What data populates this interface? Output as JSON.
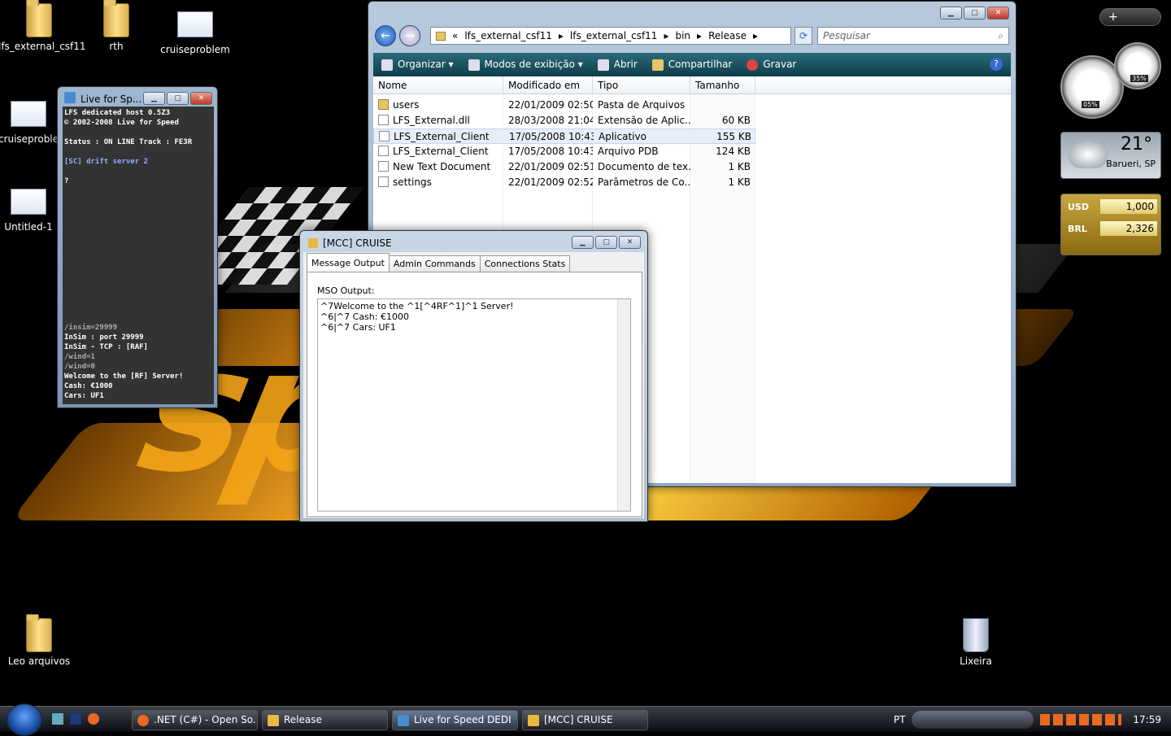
{
  "desktop": {
    "icons": [
      {
        "label": "lfs_external_csf11",
        "type": "folder"
      },
      {
        "label": "rth",
        "type": "folder"
      },
      {
        "label": "cruiseproblem",
        "type": "image"
      },
      {
        "label": "cruiseproble",
        "type": "image"
      },
      {
        "label": "Untitled-1",
        "type": "image"
      },
      {
        "label": "Leo arquivos",
        "type": "folder"
      },
      {
        "label": "Lixeira",
        "type": "recycle-bin"
      }
    ]
  },
  "explorer": {
    "breadcrumb": [
      "«",
      "lfs_external_csf11",
      "lfs_external_csf11",
      "bin",
      "Release"
    ],
    "search_placeholder": "Pesquisar",
    "toolbar": {
      "organize": "Organizar",
      "views": "Modos de exibição",
      "open": "Abrir",
      "share": "Compartilhar",
      "burn": "Gravar"
    },
    "columns": [
      "Nome",
      "Modificado em",
      "Tipo",
      "Tamanho"
    ],
    "files": [
      {
        "name": "users",
        "modified": "22/01/2009 02:50",
        "type": "Pasta de Arquivos",
        "size": ""
      },
      {
        "name": "LFS_External.dll",
        "modified": "28/03/2008 21:04",
        "type": "Extensão de Aplic...",
        "size": "60 KB"
      },
      {
        "name": "LFS_External_Client",
        "modified": "17/05/2008 10:43",
        "type": "Aplicativo",
        "size": "155 KB"
      },
      {
        "name": "LFS_External_Client",
        "modified": "17/05/2008 10:43",
        "type": "Arquivo PDB",
        "size": "124 KB"
      },
      {
        "name": "New Text Document",
        "modified": "22/01/2009 02:51",
        "type": "Documento de tex...",
        "size": "1 KB"
      },
      {
        "name": "settings",
        "modified": "22/01/2009 02:52",
        "type": "Parâmetros de Co...",
        "size": "1 KB"
      }
    ]
  },
  "lfs_window": {
    "title": "Live for Sp...",
    "lines": [
      "LFS dedicated host 0.5Z3",
      "© 2002-2008 Live for Speed",
      "",
      "Status : ON LINE   Track : FE3R",
      "",
      "[SC] drift server 2",
      "",
      "?"
    ],
    "log": [
      "/insim=29999",
      "InSim : port 29999",
      "InSim - TCP : [RAF]",
      "/wind=1",
      "/wind=0",
      "Welcome to the [RF] Server!",
      "Cash: €1000",
      "Cars: UF1"
    ]
  },
  "mcc_window": {
    "title": "[MCC] CRUISE",
    "tabs": [
      "Message Output",
      "Admin Commands",
      "Connections Stats"
    ],
    "mso_label": "MSO Output:",
    "mso_lines": [
      "^7Welcome to the ^1[^4RF^1]^1 Server!",
      "^6|^7 Cash: €1000",
      "^6|^7 Cars: UF1"
    ]
  },
  "gadgets": {
    "cpu": "05%",
    "mem": "35%",
    "weather_temp": "21°",
    "weather_city": "Barueri, SP",
    "currency": [
      {
        "code": "USD",
        "value": "1,000"
      },
      {
        "code": "BRL",
        "value": "2,326"
      }
    ]
  },
  "taskbar": {
    "buttons": [
      ".NET (C#) - Open So...",
      "Release",
      "Live for Speed DEDI",
      "[MCC] CRUISE"
    ],
    "lang": "PT",
    "clock": "17:59"
  }
}
